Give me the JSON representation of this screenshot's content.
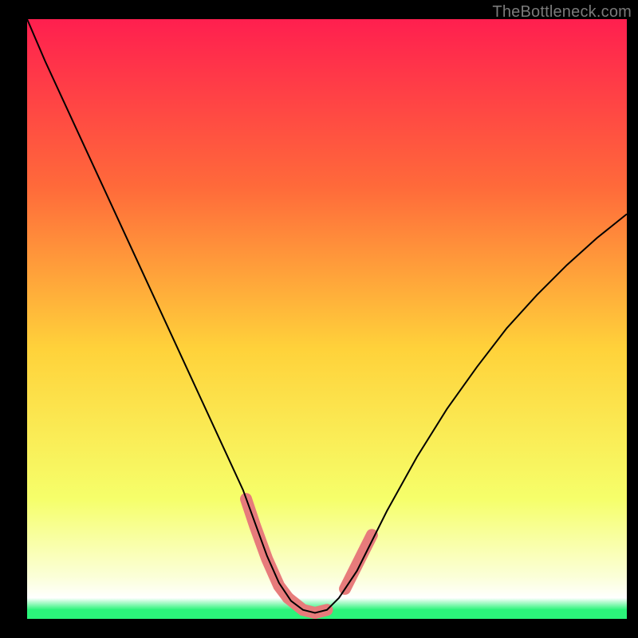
{
  "watermark": "TheBottleneck.com",
  "colors": {
    "bg": "#000000",
    "grad_top": "#ff1f4f",
    "grad_mid_upper": "#ff6a3a",
    "grad_mid": "#ffd23a",
    "grad_lower": "#f6ff6a",
    "grad_pale": "#fbffd8",
    "grad_green": "#2bf47a",
    "curve": "#000000",
    "highlight": "#e77b7b"
  },
  "chart_data": {
    "type": "line",
    "title": "",
    "xlabel": "",
    "ylabel": "",
    "xlim": [
      0,
      100
    ],
    "ylim": [
      0,
      100
    ],
    "series": [
      {
        "name": "curve",
        "x": [
          0,
          3,
          6,
          9,
          12,
          15,
          18,
          21,
          24,
          27,
          30,
          33,
          36,
          38,
          40,
          42,
          44,
          46,
          48,
          50,
          52,
          55,
          60,
          65,
          70,
          75,
          80,
          85,
          90,
          95,
          100
        ],
        "y": [
          100,
          93,
          86.5,
          80,
          73.5,
          67,
          60.5,
          54,
          47.5,
          41,
          34.5,
          28,
          21.5,
          16,
          10.5,
          6,
          3,
          1.5,
          1,
          1.5,
          3.5,
          8,
          18,
          27,
          35,
          42,
          48.5,
          54,
          59,
          63.5,
          67.5
        ]
      }
    ],
    "highlight_segments": [
      {
        "name": "left-descent",
        "x": [
          36.5,
          38,
          40,
          42,
          43.5
        ],
        "y": [
          20,
          15.5,
          10,
          5.5,
          3.5
        ]
      },
      {
        "name": "valley-floor",
        "x": [
          43.5,
          46,
          48,
          50
        ],
        "y": [
          3.5,
          1.5,
          1,
          1.5
        ]
      },
      {
        "name": "right-ascent",
        "x": [
          53,
          54.5,
          56,
          57.5
        ],
        "y": [
          5,
          8,
          11,
          14
        ]
      }
    ]
  }
}
